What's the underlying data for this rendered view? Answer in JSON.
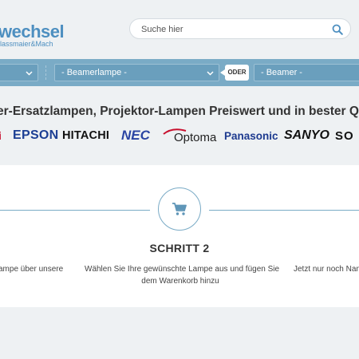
{
  "logo": {
    "main": "wechsel",
    "sub": "lassmaier&Mach"
  },
  "search": {
    "placeholder": "Suche hier"
  },
  "selectors": {
    "first": "",
    "lampe": "- Beamerlampe -",
    "oder": "ODER",
    "beamer": "- Beamer -"
  },
  "headline": "er-Ersatzlampen, Projektor-Lampen Preiswert und in bester Q",
  "brands": [
    "i",
    "EPSON",
    "HITACHI",
    "NEC",
    "Optoma",
    "Panasonic",
    "SANYO",
    "SO"
  ],
  "steps": {
    "title": "SCHRITT 2",
    "left_text": "ampe über unsere",
    "center_line1": "Wählen Sie Ihre gewünschte Lampe aus und fügen Sie",
    "center_line2": "dem Warenkorb hinzu",
    "right_text": "Jetzt nur noch Nam"
  },
  "colors": {
    "bar": "#7aabc6",
    "logo": "#4d8fc0",
    "epson": "#1c3f94",
    "nec": "#2a44a3",
    "optoma": "#c8102e",
    "panasonic": "#1d3a8f"
  }
}
